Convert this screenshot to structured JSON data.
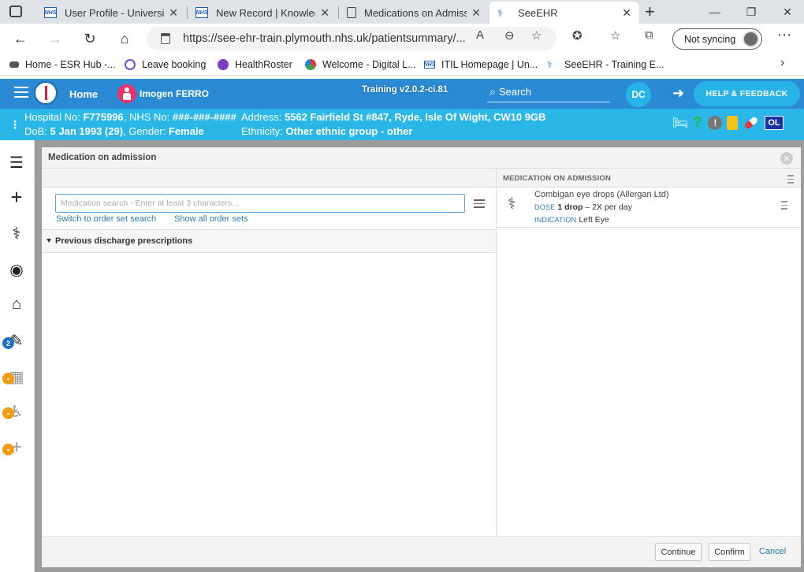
{
  "browser": {
    "tabs": [
      {
        "title": "User Profile - University"
      },
      {
        "title": "New Record | Knowledg"
      },
      {
        "title": "Medications on Admiss"
      },
      {
        "title": "SeeEHR"
      }
    ],
    "new_tab": "+",
    "url": "https://see-ehr-train.plymouth.nhs.uk/patientsummary/...",
    "sync_label": "Not syncing",
    "bookmarks": [
      {
        "label": "Home - ESR Hub -..."
      },
      {
        "label": "Leave booking"
      },
      {
        "label": "HealthRoster"
      },
      {
        "label": "Welcome - Digital L..."
      },
      {
        "label": "ITIL Homepage | Un..."
      },
      {
        "label": "SeeEHR - Training E..."
      }
    ]
  },
  "app": {
    "home_label": "Home",
    "patient_name": "Imogen FERRO",
    "training_label": "Training v2.0.2-ci.81",
    "search_label": "Search",
    "user_initials": "DC",
    "help_label": "HELP & FEEDBACK",
    "ol_label": "OL"
  },
  "banner": {
    "hospital_label": "Hospital No:",
    "hospital_no": "F775996",
    "nhs_label": "NHS No:",
    "nhs_no": "###-###-####",
    "dob_label": "DoB:",
    "dob": "5 Jan 1993 (29)",
    "gender_label": "Gender:",
    "gender": "Female",
    "address_label": "Address:",
    "address": "5562 Fairfield St #847, Ryde, Isle Of Wight, CW10 9GB",
    "ethnicity_label": "Ethnicity:",
    "ethnicity": "Other ethnic group - other"
  },
  "sidebar": {
    "badge_count": "2"
  },
  "modal": {
    "title": "Medication on admission",
    "search_placeholder": "Medication search - Enter at least 3 characters...",
    "switch_link": "Switch to order set search",
    "show_all_link": "Show all order sets",
    "previous_section": "Previous discharge prescriptions",
    "right_header": "MEDICATION ON ADMISSION",
    "medication": {
      "name": "Combigan eye drops (Allergan Ltd)",
      "dose_label": "DOSE",
      "dose": "1 drop",
      "frequency": "– 2X per day",
      "indication_label": "INDICATION",
      "indication": "Left Eye"
    },
    "continue_label": "Continue",
    "confirm_label": "Confirm",
    "cancel_label": "Cancel"
  }
}
